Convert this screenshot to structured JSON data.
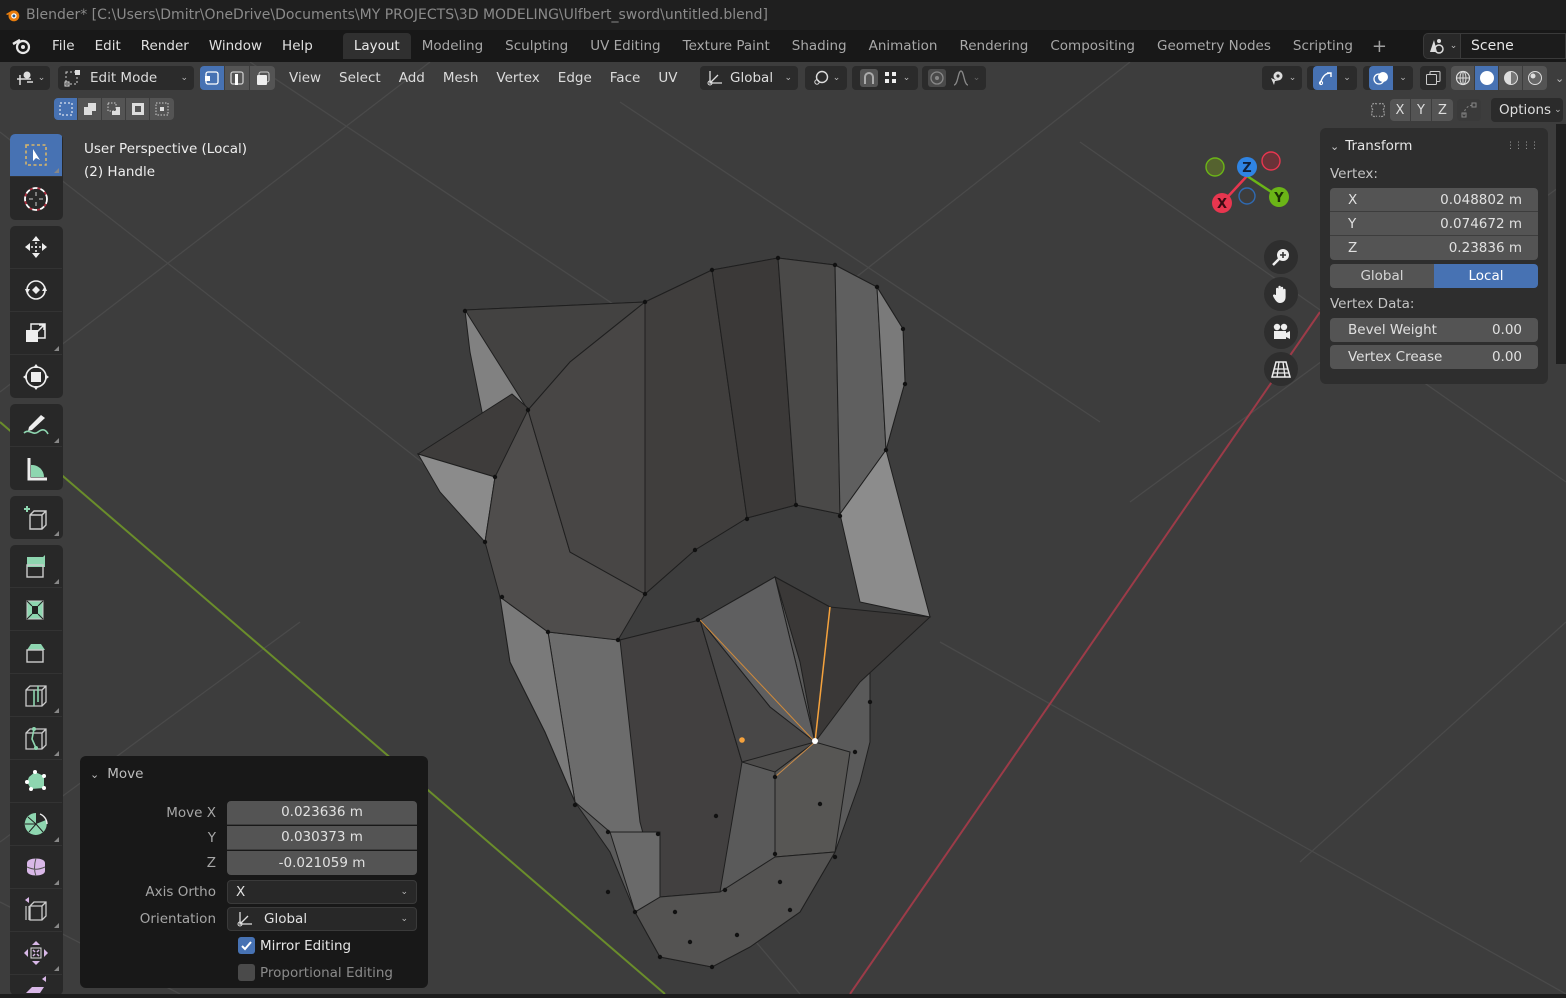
{
  "window": {
    "title": "Blender* [C:\\Users\\Dmitr\\OneDrive\\Documents\\MY PROJECTS\\3D MODELING\\Ulfbert_sword\\untitled.blend]"
  },
  "topbar": {
    "menus": [
      "File",
      "Edit",
      "Render",
      "Window",
      "Help"
    ],
    "workspaces": [
      "Layout",
      "Modeling",
      "Sculpting",
      "UV Editing",
      "Texture Paint",
      "Shading",
      "Animation",
      "Rendering",
      "Compositing",
      "Geometry Nodes",
      "Scripting"
    ],
    "active_workspace": "Layout",
    "add_workspace": "+",
    "scene_name": "Scene"
  },
  "viewport_header": {
    "mode": "Edit Mode",
    "select_modes": [
      "vertex",
      "edge",
      "face"
    ],
    "active_select_mode": "vertex",
    "menus": [
      "View",
      "Select",
      "Add",
      "Mesh",
      "Vertex",
      "Edge",
      "Face",
      "UV"
    ],
    "transform_orientation": "Global",
    "axis_buttons": [
      "X",
      "Y",
      "Z"
    ],
    "options_label": "Options",
    "shading_modes": [
      "wireframe",
      "solid",
      "material",
      "rendered"
    ],
    "active_shading": "solid"
  },
  "overlay_text": {
    "view_name": "User Perspective (Local)",
    "object_name": "(2) Handle"
  },
  "gizmo": {
    "axes": {
      "x": "X",
      "y": "Y",
      "z": "Z"
    },
    "colors": {
      "x": "#e8364f",
      "y": "#6bb517",
      "z": "#2f84e3"
    }
  },
  "toolbar": {
    "tools": [
      {
        "name": "select-box",
        "active": true
      },
      {
        "name": "cursor"
      },
      {
        "name": "move"
      },
      {
        "name": "rotate"
      },
      {
        "name": "scale"
      },
      {
        "name": "transform"
      },
      {
        "name": "annotate"
      },
      {
        "name": "measure"
      },
      {
        "name": "add-cube"
      },
      {
        "name": "extrude-region"
      },
      {
        "name": "inset-faces"
      },
      {
        "name": "bevel"
      },
      {
        "name": "loop-cut"
      },
      {
        "name": "knife"
      },
      {
        "name": "poly-build"
      },
      {
        "name": "spin"
      },
      {
        "name": "smooth"
      },
      {
        "name": "edge-slide"
      },
      {
        "name": "shrink-fatten"
      },
      {
        "name": "shear"
      }
    ]
  },
  "npanel": {
    "title": "Transform",
    "vertex_label": "Vertex:",
    "vertex": [
      {
        "axis": "X",
        "value": "0.048802 m"
      },
      {
        "axis": "Y",
        "value": "0.074672 m"
      },
      {
        "axis": "Z",
        "value": "0.23836 m"
      }
    ],
    "space_toggle": [
      "Global",
      "Local"
    ],
    "active_space": "Local",
    "vertex_data_label": "Vertex Data:",
    "vertex_data": [
      {
        "label": "Bevel Weight",
        "value": "0.00"
      },
      {
        "label": "Vertex Crease",
        "value": "0.00"
      }
    ]
  },
  "move_panel": {
    "title": "Move",
    "fields": [
      {
        "label": "Move X",
        "value": "0.023636 m"
      },
      {
        "label": "Y",
        "value": "0.030373 m"
      },
      {
        "label": "Z",
        "value": "-0.021059 m"
      }
    ],
    "axis_ortho_label": "Axis Ortho",
    "axis_ortho_value": "X",
    "orientation_label": "Orientation",
    "orientation_value": "Global",
    "mirror_editing_label": "Mirror Editing",
    "mirror_editing": true,
    "proportional_editing_label": "Proportional Editing",
    "proportional_editing": false
  },
  "colors": {
    "accent": "#4772b3",
    "viewport_bg": "#3d3d3d",
    "selected": "#f5a23d"
  }
}
